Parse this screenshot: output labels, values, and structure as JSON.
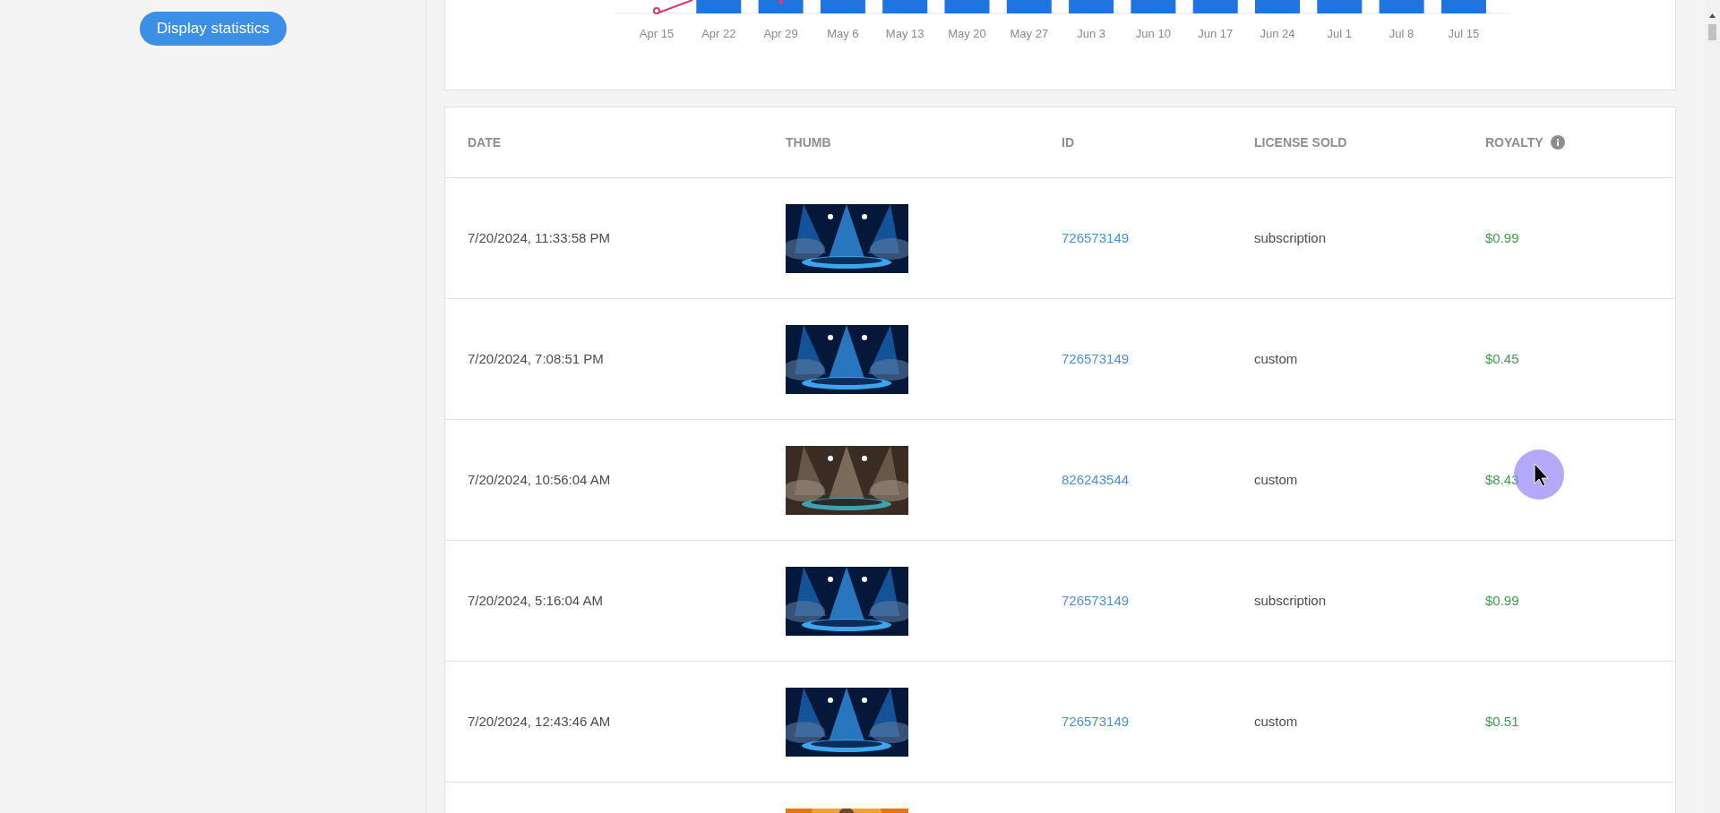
{
  "sidebar": {
    "button": "Display statistics"
  },
  "chart": {
    "x_labels": [
      "Apr 15",
      "Apr 22",
      "Apr 29",
      "May 6",
      "May 13",
      "May 20",
      "May 27",
      "Jun 3",
      "Jun 10",
      "Jun 17",
      "Jun 24",
      "Jul 1",
      "Jul 8",
      "Jul 15"
    ]
  },
  "table": {
    "columns": [
      {
        "label": "DATE"
      },
      {
        "label": "THUMB"
      },
      {
        "label": "ID"
      },
      {
        "label": "LICENSE SOLD"
      },
      {
        "label": "ROYALTY",
        "info": true
      }
    ],
    "rows": [
      {
        "date": "7/20/2024, 11:33:58 PM",
        "thumb": {
          "kind": "picture"
        },
        "id": "726573149",
        "license": "subscription",
        "royalty": "$0.99"
      },
      {
        "date": "7/20/2024, 7:08:51 PM",
        "thumb": {
          "kind": "picture"
        },
        "id": "726573149",
        "license": "custom",
        "royalty": "$0.45"
      },
      {
        "date": "7/20/2024, 10:56:04 AM",
        "thumb": {
          "kind": "picture"
        },
        "id": "826243544",
        "license": "custom",
        "royalty": "$8.43"
      },
      {
        "date": "7/20/2024, 5:16:04 AM",
        "thumb": {
          "kind": "picture"
        },
        "id": "726573149",
        "license": "subscription",
        "royalty": "$0.99"
      },
      {
        "date": "7/20/2024, 12:43:46 AM",
        "thumb": {
          "kind": "picture"
        },
        "id": "726573149",
        "license": "custom",
        "royalty": "$0.51"
      },
      {
        "thumb": {
          "kind": "picture"
        }
      }
    ]
  }
}
